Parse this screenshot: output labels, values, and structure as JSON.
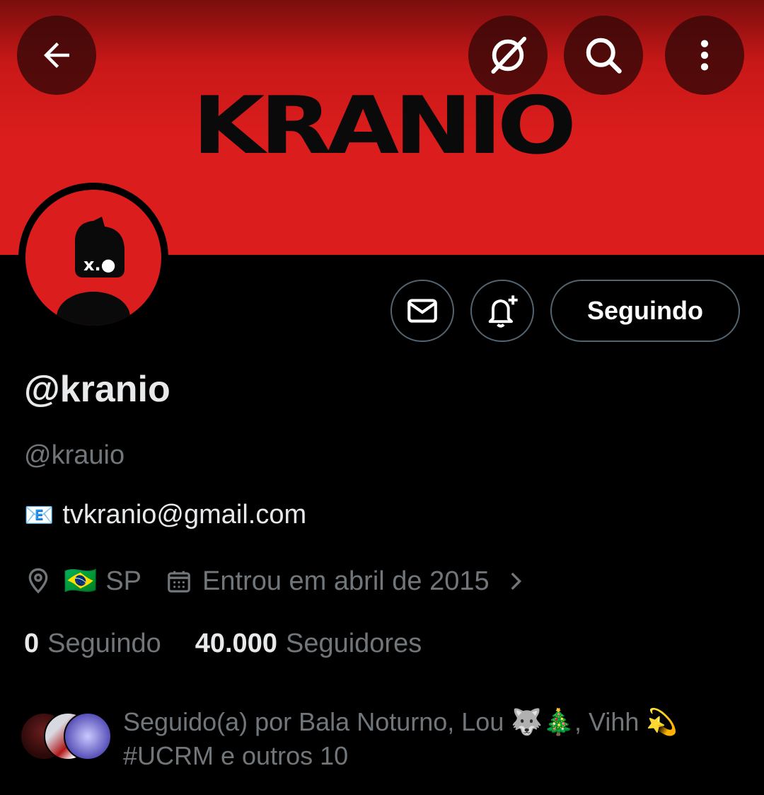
{
  "banner": {
    "logo_text": "KRANIO",
    "bg_color": "#dc1d1d"
  },
  "toolbar": {
    "back": "arrow-left-icon",
    "grok": "slash-circle-icon",
    "search": "search-icon",
    "more": "more-vertical-icon"
  },
  "avatar": {
    "face_text": "x.●"
  },
  "actions": {
    "message_icon": "mail-icon",
    "notify_icon": "bell-plus-icon",
    "follow_label": "Seguindo"
  },
  "profile": {
    "display_name": "@kranio",
    "handle": "@krauio",
    "bio_emoji": "📧",
    "bio_text": "tvkranio@gmail.com",
    "location_flag": "🇧🇷",
    "location": "SP",
    "joined": "Entrou em abril de 2015"
  },
  "stats": {
    "following_count": "0",
    "following_label": "Seguindo",
    "followers_count": "40.000",
    "followers_label": "Seguidores"
  },
  "followed_by": {
    "text_line1": "Seguido(a) por Bala Noturno, Lou 🐺🎄, Vihh 💫",
    "text_line2": "#UCRM e outros 10"
  },
  "colors": {
    "accent": "#dc1d1d",
    "muted": "#71767b",
    "text": "#e7e9ea",
    "border": "#536471"
  }
}
